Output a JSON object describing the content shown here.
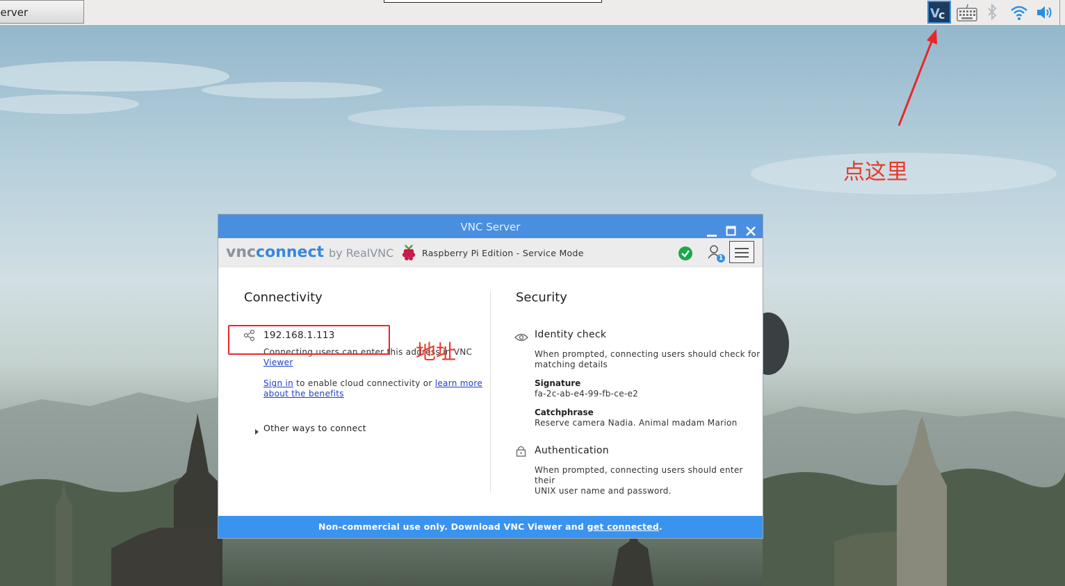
{
  "taskbar": {
    "task_button_label": "Server",
    "tray_icons": [
      "vnc-icon",
      "keyboard-icon",
      "bluetooth-icon",
      "wifi-icon",
      "volume-icon"
    ]
  },
  "annotations": {
    "click_here": "点这里",
    "address": "地址"
  },
  "window": {
    "title": "VNC Server",
    "brand_vnc": "vnc",
    "brand_connect": "connect",
    "brand_by": "by RealVNC",
    "edition": "Raspberry Pi Edition - Service Mode",
    "user_count": "1",
    "connectivity": {
      "heading": "Connectivity",
      "address": "192.168.1.113",
      "address_desc_1": "Connecting users can enter this address in VNC",
      "address_desc_link": "Viewer",
      "sign_in_link": "Sign in",
      "sign_in_text": " to enable cloud connectivity or ",
      "learn_more_link_1": "learn more",
      "learn_more_link_2": "about the benefits",
      "other_ways": "Other ways to connect"
    },
    "security": {
      "heading": "Security",
      "identity_title": "Identity check",
      "identity_desc_1": "When prompted, connecting users should check for",
      "identity_desc_2": "matching details",
      "signature_label": "Signature",
      "signature_value": "fa-2c-ab-e4-99-fb-ce-e2",
      "catchphrase_label": "Catchphrase",
      "catchphrase_value": "Reserve camera Nadia. Animal madam Marion",
      "auth_title": "Authentication",
      "auth_desc_1": "When prompted, connecting users should enter their",
      "auth_desc_2": "UNIX user name and password."
    },
    "footer": {
      "text": "Non-commercial use only. Download VNC Viewer and ",
      "link": "get connected",
      "end": "."
    }
  },
  "colors": {
    "titlebar": "#4a8ee0",
    "footer": "#3a93ee",
    "annotation_red": "#e83a2a",
    "status_green": "#1ba84a",
    "link_blue": "#1a3ec9"
  }
}
